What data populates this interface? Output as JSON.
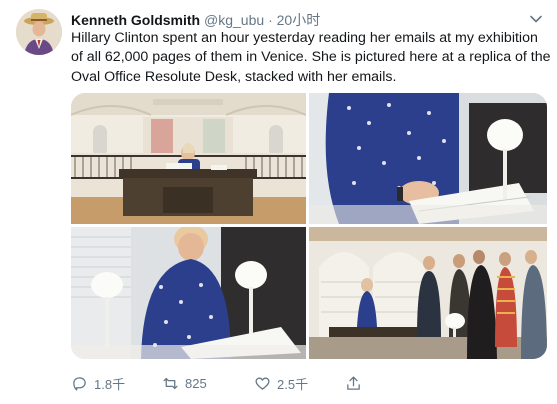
{
  "tweet": {
    "author_name": "Kenneth Goldsmith",
    "handle": "@kg_ubu",
    "separator": "·",
    "time": "20小时",
    "text_lines": [
      "Hillary Clinton spent an hour yesterday reading her emails at my exhibition",
      "of all 62,000 pages of them in Venice. She is pictured here at a replica of the",
      "Oval Office Resolute Desk, stacked with her emails."
    ],
    "media_count": 4
  },
  "icons": {
    "avatar": "avatar",
    "menu": "chevron-down-icon",
    "reply": "reply-icon",
    "retweet": "retweet-icon",
    "like": "heart-icon",
    "share": "share-icon"
  },
  "actions": {
    "reply_count": "1.8千",
    "retweet_count": "825",
    "like_count": "2.5千"
  },
  "colors": {
    "text": "#14171a",
    "secondary": "#657786",
    "dress": "#2b3f8c"
  }
}
